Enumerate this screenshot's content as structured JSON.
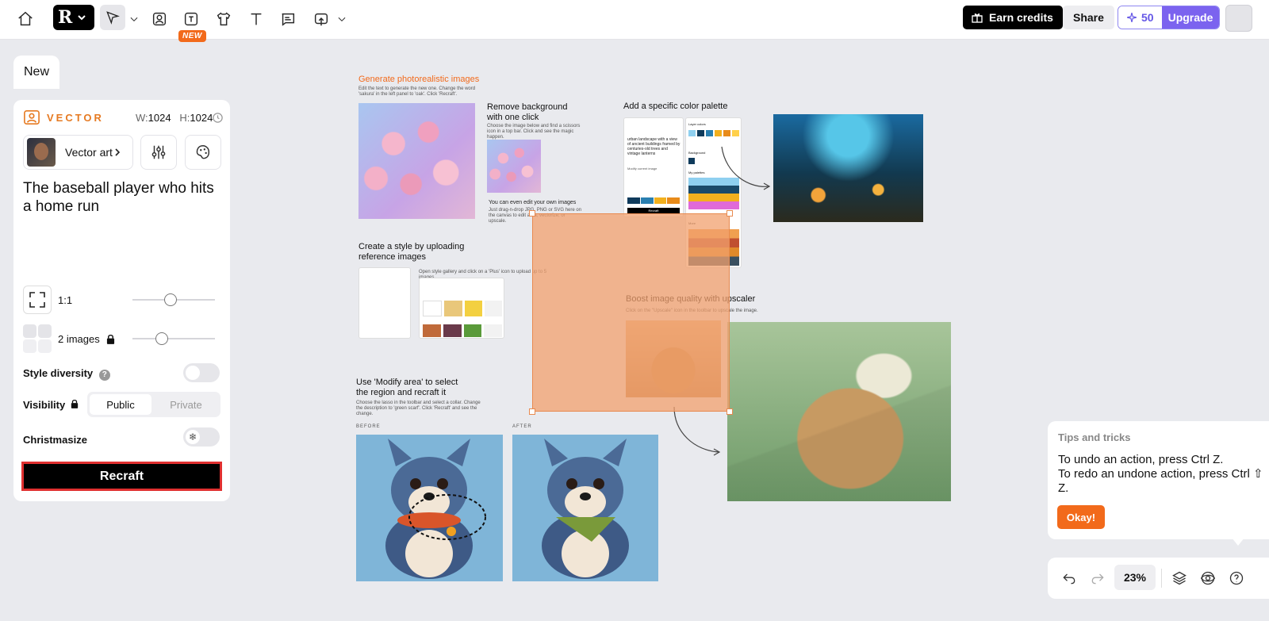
{
  "topbar": {
    "new_badge": "NEW",
    "earn_credits": "Earn credits",
    "share": "Share",
    "credits_count": "50",
    "upgrade": "Upgrade",
    "icons": [
      "home-icon",
      "recraft-logo",
      "pointer-icon",
      "image-icon",
      "text-image-icon",
      "tshirt-icon",
      "text-icon",
      "chat-icon",
      "upload-icon"
    ]
  },
  "new_tab": "New",
  "panel": {
    "model_label": "VECTOR",
    "w_label": "W:",
    "w_value": "1024",
    "h_label": "H:",
    "h_value": "1024",
    "style_name": "Vector art",
    "prompt": "The baseball player who hits a home run",
    "aspect_ratio": "1:1",
    "images_count": "2 images",
    "style_diversity": "Style diversity",
    "visibility": "Visibility",
    "public": "Public",
    "private": "Private",
    "christmasize": "Christmasize",
    "recraft_button": "Recraft",
    "colors": {
      "accent": "#e67a22",
      "button": "#000000",
      "button_border": "#e03030"
    }
  },
  "canvas": {
    "gen_title": "Generate photorealistic images",
    "gen_sub": "Edit the text to generate the new one. Change the word 'sakura' in the left panel to 'oak'. Click 'Recraft'.",
    "bg_title": "Remove background with one click",
    "bg_sub": "Choose the image below and find a scissors icon in a top bar. Click and see the magic happen.",
    "edit_own": "You can even edit your own images",
    "edit_own_sub": "Just drag-n-drop JPG, PNG or SVG here on the canvas to edit area, vectorize, or upscale.",
    "palette_title": "Add a specific color palette",
    "style_title": "Create a style by uploading reference images",
    "style_sub": "Open style gallery and click on a 'Plus' icon to upload up to 5 images.",
    "upscale_title": "Boost image quality with upscaler",
    "upscale_sub": "Click on the \"Upscale\" icon in the toolbar to upscale the image.",
    "modify_title": "Use 'Modify area' to select the region and recraft it",
    "modify_sub": "Choose the lasso in the toolbar and select a collar. Change the description to 'green scarf'. Click 'Recraft' and see the change.",
    "before": "BEFORE",
    "after": "AFTER",
    "palette_card": {
      "layer_colors": "Layer colors",
      "background": "Background",
      "my_palettes": "My palettes",
      "more": "More",
      "prompt": "urban landscape with a view of ancient buildings framed by centuries-old trees and vintage lanterns",
      "modify": "Modify current image",
      "recraft": "Recraft"
    }
  },
  "tips": {
    "title": "Tips and tricks",
    "line1": "To undo an action, press Ctrl Z.",
    "line2": "To redo an undone action, press Ctrl ⇧ Z.",
    "okay": "Okay!"
  },
  "bottombar": {
    "zoom": "23%"
  }
}
